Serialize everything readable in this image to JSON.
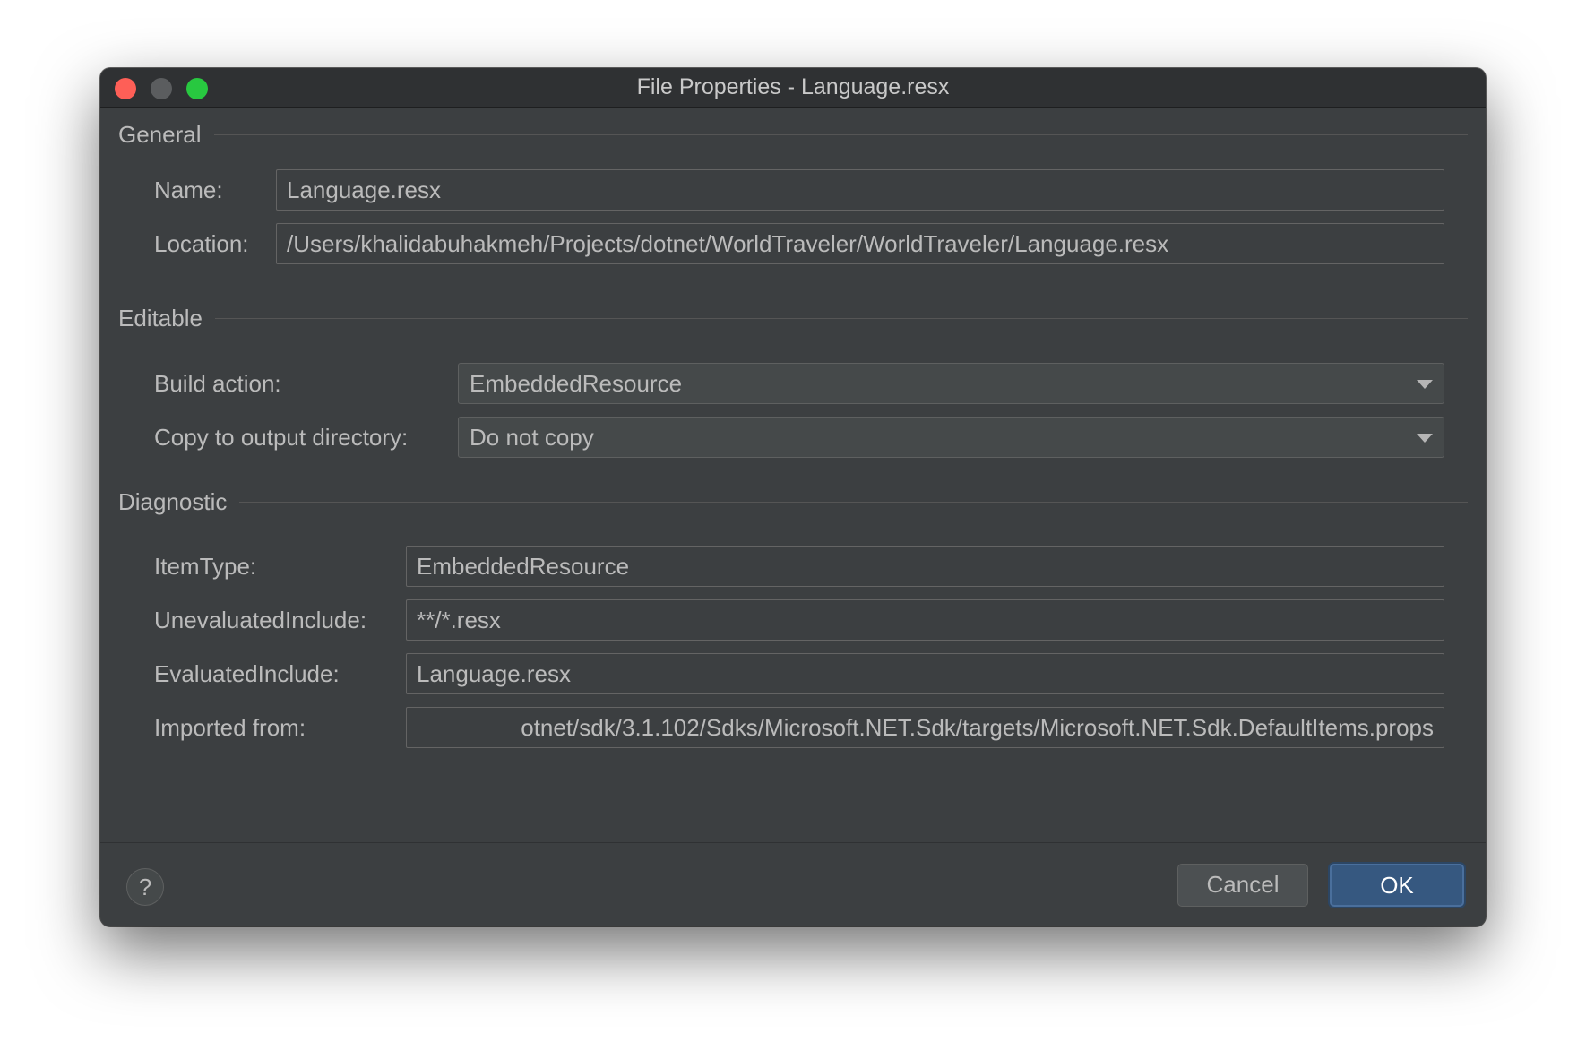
{
  "window": {
    "title": "File Properties - Language.resx"
  },
  "general": {
    "section_label": "General",
    "name_label": "Name:",
    "name_value": "Language.resx",
    "location_label": "Location:",
    "location_value": "/Users/khalidabuhakmeh/Projects/dotnet/WorldTraveler/WorldTraveler/Language.resx"
  },
  "editable": {
    "section_label": "Editable",
    "build_action_label": "Build action:",
    "build_action_value": "EmbeddedResource",
    "copy_label": "Copy to output directory:",
    "copy_value": "Do not copy"
  },
  "diagnostic": {
    "section_label": "Diagnostic",
    "item_type_label": "ItemType:",
    "item_type_value": "EmbeddedResource",
    "unevaluated_label": "UnevaluatedInclude:",
    "unevaluated_value": "**/*.resx",
    "evaluated_label": "EvaluatedInclude:",
    "evaluated_value": "Language.resx",
    "imported_label": "Imported from:",
    "imported_value": "otnet/sdk/3.1.102/Sdks/Microsoft.NET.Sdk/targets/Microsoft.NET.Sdk.DefaultItems.props"
  },
  "footer": {
    "help_label": "?",
    "cancel_label": "Cancel",
    "ok_label": "OK"
  },
  "icons": {
    "close": "close-window-icon",
    "minimize": "minimize-window-icon",
    "maximize": "maximize-window-icon",
    "dropdown": "chevron-down-icon"
  },
  "colors": {
    "window_bg": "#3c3f41",
    "titlebar_bg": "#2f3133",
    "text": "#bbbbbb",
    "close": "#fe5f57",
    "minimize": "#5b5d5f",
    "maximize": "#28c840",
    "ok_button": "#365880"
  }
}
